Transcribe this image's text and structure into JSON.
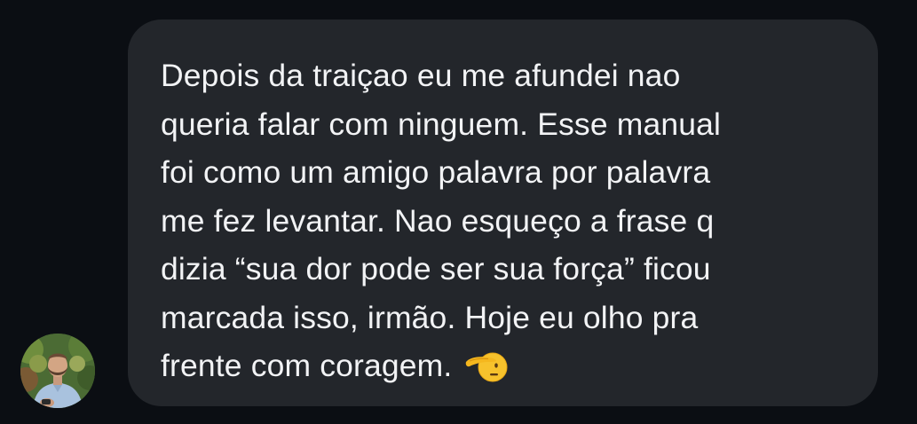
{
  "conversation": {
    "sender_avatar_icon": "profile-photo-avatar",
    "message": {
      "text": "Depois da traiçao eu me afundei nao\nqueria falar com ninguem. Esse manual\nfoi como um amigo palavra por palavra\nme fez levantar. Nao esqueço a frase q\ndizia “sua dor pode ser sua força” ficou\nmarcada isso, irmão. Hoje eu olho pra\nfrente com coragem.",
      "emoji_icon": "saluting-face-icon"
    }
  },
  "colors": {
    "background": "#0b0e13",
    "bubble": "#23262b",
    "text": "#f2f3f5",
    "emoji": "#f7c22c"
  }
}
